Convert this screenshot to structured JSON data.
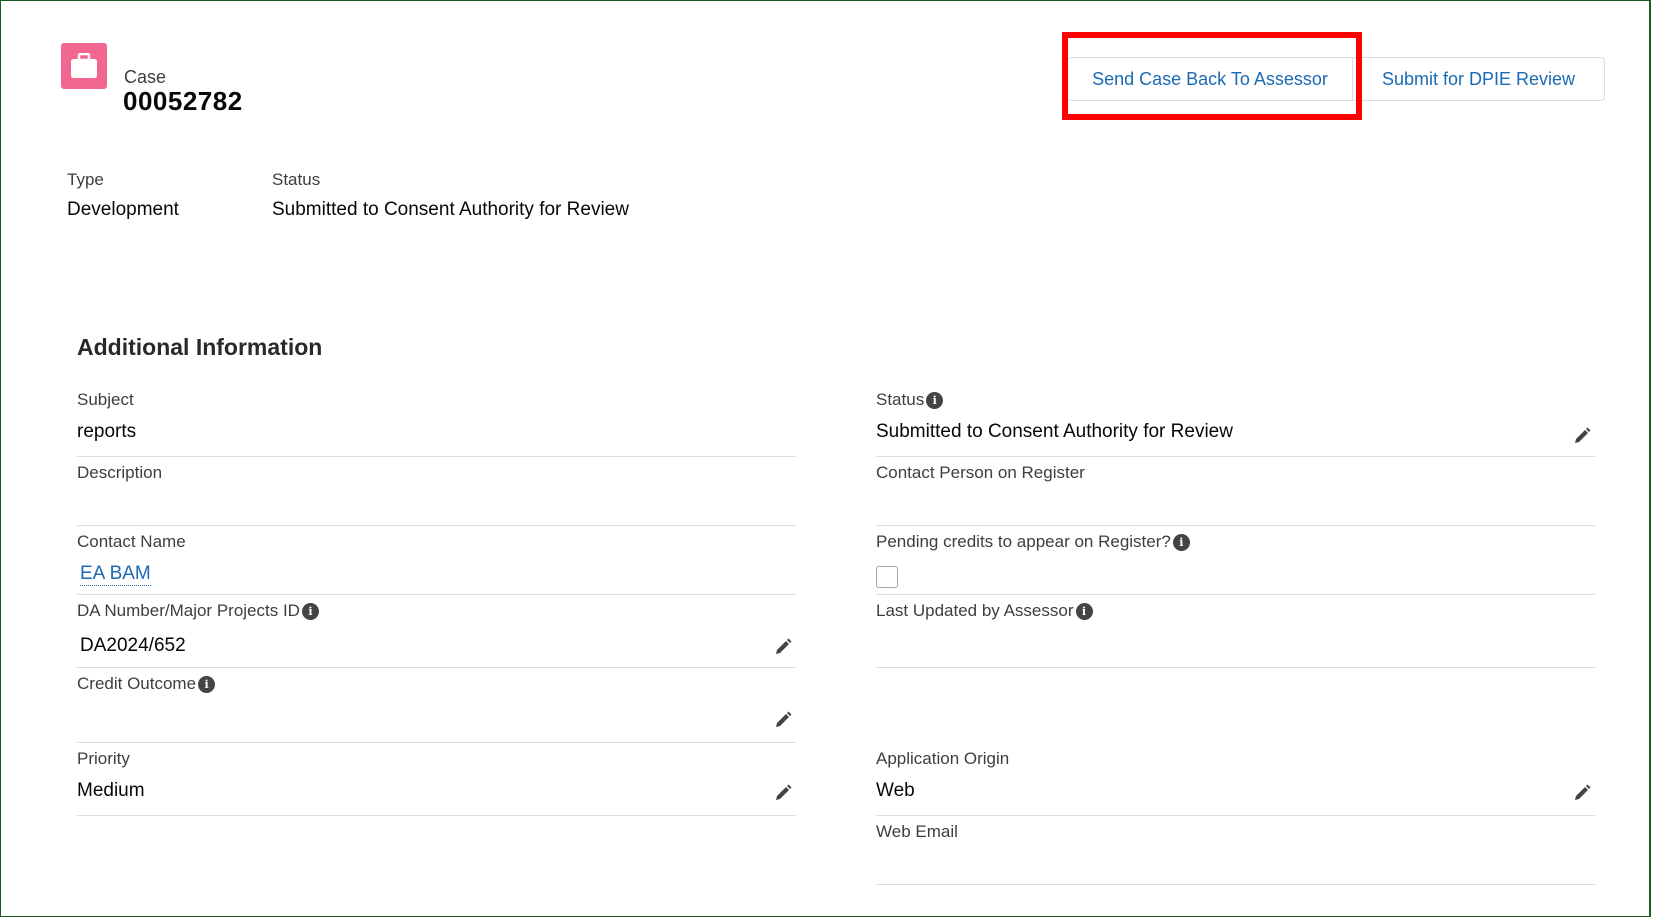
{
  "header": {
    "object_label": "Case",
    "case_number": "00052782",
    "icon": "briefcase-icon",
    "icon_color": "#f2678f",
    "buttons": {
      "send_back": "Send Case Back To Assessor",
      "submit_dpie": "Submit for DPIE Review"
    }
  },
  "highlights": {
    "type_label": "Type",
    "type_value": "Development",
    "status_label": "Status",
    "status_value": "Submitted to Consent Authority for Review"
  },
  "section": {
    "title": "Additional Information",
    "left": {
      "subject_label": "Subject",
      "subject_value": "reports",
      "description_label": "Description",
      "description_value": "",
      "contact_name_label": "Contact Name",
      "contact_name_value": "EA BAM",
      "da_number_label": "DA Number/Major Projects ID",
      "da_number_value": "DA2024/652",
      "credit_outcome_label": "Credit Outcome",
      "credit_outcome_value": "",
      "priority_label": "Priority",
      "priority_value": "Medium"
    },
    "right": {
      "status_label": "Status",
      "status_value": "Submitted to Consent Authority for Review",
      "contact_person_label": "Contact Person on Register",
      "contact_person_value": "",
      "pending_credits_label": "Pending credits to appear on Register?",
      "pending_credits_checked": false,
      "last_updated_label": "Last Updated by Assessor",
      "last_updated_value": "",
      "application_origin_label": "Application Origin",
      "application_origin_value": "Web",
      "web_email_label": "Web Email",
      "web_email_value": ""
    }
  },
  "colors": {
    "link": "#1b6ab5",
    "highlight_box": "#ff0000",
    "border": "#d8dde6"
  }
}
